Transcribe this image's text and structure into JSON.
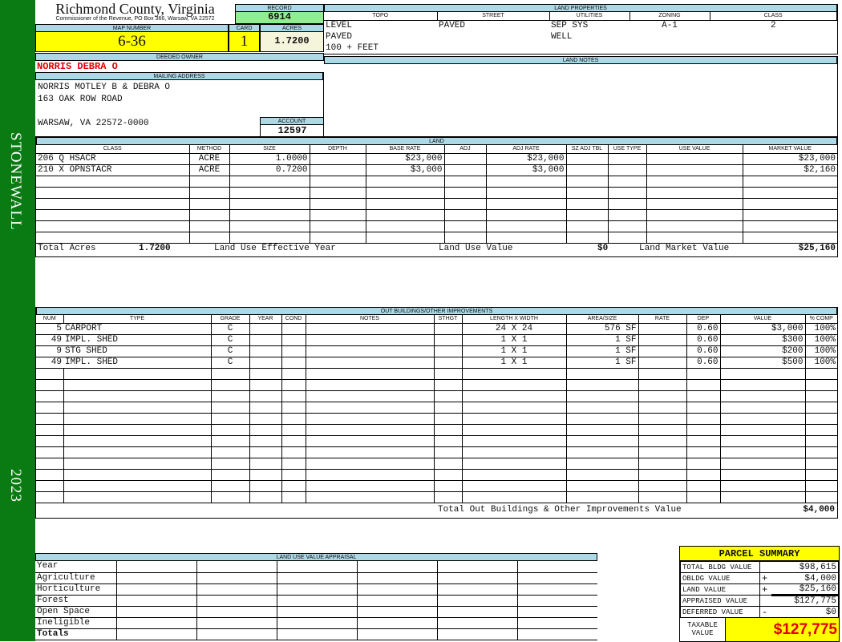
{
  "sidebar": {
    "district": "STONEWALL",
    "year": "2023",
    "color": "#0a7a12"
  },
  "header": {
    "county": "Richmond County, Virginia",
    "address": "Commissioner of the Revenue, PO Box 366, Warsaw, VA 22572"
  },
  "record": {
    "label": "RECORD",
    "value": "6914"
  },
  "map": {
    "label": "MAP NUMBER",
    "value": "6-36"
  },
  "card": {
    "label": "CARD",
    "value": "1"
  },
  "acres": {
    "label": "ACRES",
    "value": "1.7200"
  },
  "owner": {
    "label": "DEEDED OWNER",
    "value": "NORRIS DEBRA O"
  },
  "mailing": {
    "label": "MAILING ADDRESS",
    "lines": [
      "NORRIS MOTLEY B & DEBRA O",
      "163 OAK ROW ROAD",
      "",
      "WARSAW, VA 22572-0000"
    ]
  },
  "account": {
    "label": "ACCOUNT",
    "value": "12597"
  },
  "land_properties": {
    "label": "LAND PROPERTIES",
    "columns": [
      "TOPO",
      "STREET",
      "UTILITIES",
      "ZONING",
      "CLASS"
    ],
    "rows": [
      [
        "LEVEL",
        "PAVED",
        "SEP SYS",
        "A-1",
        "2"
      ],
      [
        "PAVED",
        "",
        "WELL",
        "",
        ""
      ],
      [
        "100 + FEET",
        "",
        "",
        "",
        ""
      ]
    ]
  },
  "land_notes": {
    "label": "LAND NOTES"
  },
  "land": {
    "label": "LAND",
    "columns": [
      "CLASS",
      "METHOD",
      "SIZE",
      "DEPTH",
      "BASE RATE",
      "ADJ",
      "ADJ RATE",
      "SZ ADJ TBL",
      "USE TYPE",
      "USE VALUE",
      "MARKET VALUE"
    ],
    "rows": [
      [
        "206 Q HSACR",
        "ACRE",
        "1.0000",
        "",
        "$23,000",
        "",
        "$23,000",
        "",
        "",
        "",
        "$23,000"
      ],
      [
        "210 X OPNSTACR",
        "ACRE",
        "0.7200",
        "",
        "$3,000",
        "",
        "$3,000",
        "",
        "",
        "",
        "$2,160"
      ]
    ],
    "totals": {
      "acres_label": "Total Acres",
      "acres": "1.7200",
      "effective_year_label": "Land Use Effective Year",
      "use_value_label": "Land Use Value",
      "use_value": "$0",
      "market_label": "Land Market Value",
      "market": "$25,160"
    }
  },
  "outbuildings": {
    "label": "OUT BUILDINGS/OTHER IMPROVEMENTS",
    "columns": [
      "NUM",
      "TYPE",
      "GRADE",
      "YEAR",
      "COND",
      "NOTES",
      "STHGT",
      "LENGTH X WIDTH",
      "AREA/SIZE",
      "RATE",
      "DEP",
      "VALUE",
      "% COMP"
    ],
    "rows": [
      [
        "5",
        "CARPORT",
        "C",
        "",
        "",
        "",
        "",
        "24 X 24",
        "576 SF",
        "",
        "0.60",
        "$3,000",
        "100%"
      ],
      [
        "49",
        "IMPL. SHED",
        "C",
        "",
        "",
        "",
        "",
        "1 X 1",
        "1 SF",
        "",
        "0.60",
        "$300",
        "100%"
      ],
      [
        "9",
        "STG SHED",
        "C",
        "",
        "",
        "",
        "",
        "1 X 1",
        "1 SF",
        "",
        "0.60",
        "$200",
        "100%"
      ],
      [
        "49",
        "IMPL. SHED",
        "C",
        "",
        "",
        "",
        "",
        "1 X 1",
        "1 SF",
        "",
        "0.60",
        "$500",
        "100%"
      ]
    ],
    "total_label": "Total Out Buildings & Other Improvements Value",
    "total": "$4,000"
  },
  "land_use_appraisal": {
    "label": "LAND USE VALUE APPRAISAL",
    "rows": [
      "Year",
      "Agriculture",
      "Horticulture",
      "Forest",
      "Open Space",
      "Ineligible",
      "Totals"
    ]
  },
  "parcel_summary": {
    "label": "PARCEL SUMMARY",
    "rows": [
      {
        "label": "TOTAL BLDG VALUE",
        "sign": "",
        "value": "$98,615"
      },
      {
        "label": "OBLDG VALUE",
        "sign": "+",
        "value": "$4,000"
      },
      {
        "label": "LAND VALUE",
        "sign": "+",
        "value": "$25,160"
      },
      {
        "label": "APPRAISED VALUE",
        "sign": "",
        "value": "$127,775"
      },
      {
        "label": "DEFERRED VALUE",
        "sign": "-",
        "value": "$0"
      }
    ],
    "taxable_label": "TAXABLE VALUE",
    "taxable": "$127,775"
  }
}
